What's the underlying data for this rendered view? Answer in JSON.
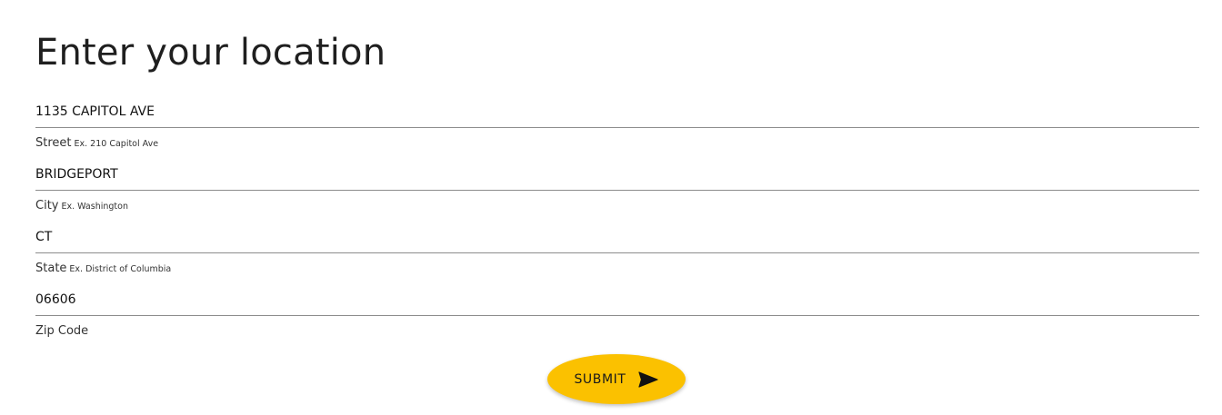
{
  "page": {
    "title": "Enter your location"
  },
  "form": {
    "street": {
      "value": "1135 CAPITOL AVE",
      "label": "Street",
      "hint": "Ex. 210 Capitol Ave"
    },
    "city": {
      "value": "BRIDGEPORT",
      "label": "City",
      "hint": "Ex. Washington"
    },
    "state": {
      "value": "CT",
      "label": "State",
      "hint": "Ex. District of Columbia"
    },
    "zip": {
      "value": "06606",
      "label": "Zip Code"
    },
    "submit": {
      "label": "SUBMIT",
      "icon": "send-icon"
    }
  },
  "colors": {
    "accent": "#fbc100",
    "divider": "#8c8c8c",
    "text": "#1f1f1f"
  }
}
